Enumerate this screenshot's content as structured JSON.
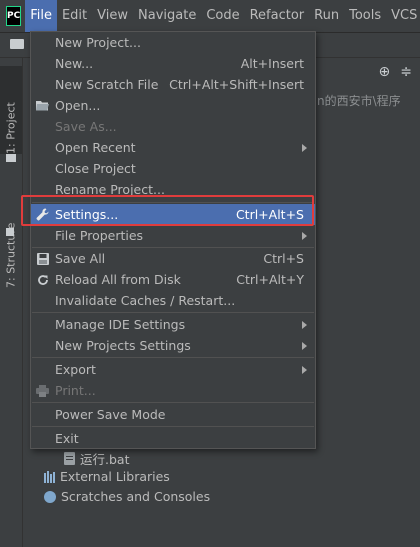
{
  "menubar": {
    "logo": "PC",
    "items": [
      {
        "label": "File",
        "mnemonic_index": 0
      },
      {
        "label": "Edit",
        "mnemonic_index": 0
      },
      {
        "label": "View",
        "mnemonic_index": 0
      },
      {
        "label": "Navigate",
        "mnemonic_index": 0
      },
      {
        "label": "Code",
        "mnemonic_index": 0
      },
      {
        "label": "Refactor",
        "mnemonic_index": 0
      },
      {
        "label": "Run",
        "mnemonic_index": 0
      },
      {
        "label": "Tools",
        "mnemonic_index": 0
      },
      {
        "label": "VCS",
        "mnemonic_index": 0
      }
    ]
  },
  "leftstrip": {
    "project_tab": "1: Project",
    "structure_tab": "7: Structure"
  },
  "panel": {
    "path_fragment": "n的西安市\\程序",
    "tree": {
      "file_item": "运行.bat",
      "external_libraries": "External Libraries",
      "scratches": "Scratches and Consoles"
    }
  },
  "file_menu": {
    "items": [
      {
        "label": "New Project...",
        "shortcut": ""
      },
      {
        "label": "New...",
        "shortcut": "Alt+Insert"
      },
      {
        "label": "New Scratch File",
        "shortcut": "Ctrl+Alt+Shift+Insert"
      },
      {
        "label": "Open...",
        "shortcut": ""
      },
      {
        "label": "Save As...",
        "shortcut": ""
      },
      {
        "label": "Open Recent",
        "shortcut": ""
      },
      {
        "label": "Close Project",
        "shortcut": ""
      },
      {
        "label": "Rename Project...",
        "shortcut": ""
      },
      {
        "label": "Settings...",
        "shortcut": "Ctrl+Alt+S"
      },
      {
        "label": "File Properties",
        "shortcut": ""
      },
      {
        "label": "Save All",
        "shortcut": "Ctrl+S"
      },
      {
        "label": "Reload All from Disk",
        "shortcut": "Ctrl+Alt+Y"
      },
      {
        "label": "Invalidate Caches / Restart...",
        "shortcut": ""
      },
      {
        "label": "Manage IDE Settings",
        "shortcut": ""
      },
      {
        "label": "New Projects Settings",
        "shortcut": ""
      },
      {
        "label": "Export",
        "shortcut": ""
      },
      {
        "label": "Print...",
        "shortcut": ""
      },
      {
        "label": "Power Save Mode",
        "shortcut": ""
      },
      {
        "label": "Exit",
        "shortcut": ""
      }
    ]
  },
  "colors": {
    "selection": "#4b6eaf",
    "highlight_box": "#e03c3c",
    "background": "#3c3f41"
  }
}
